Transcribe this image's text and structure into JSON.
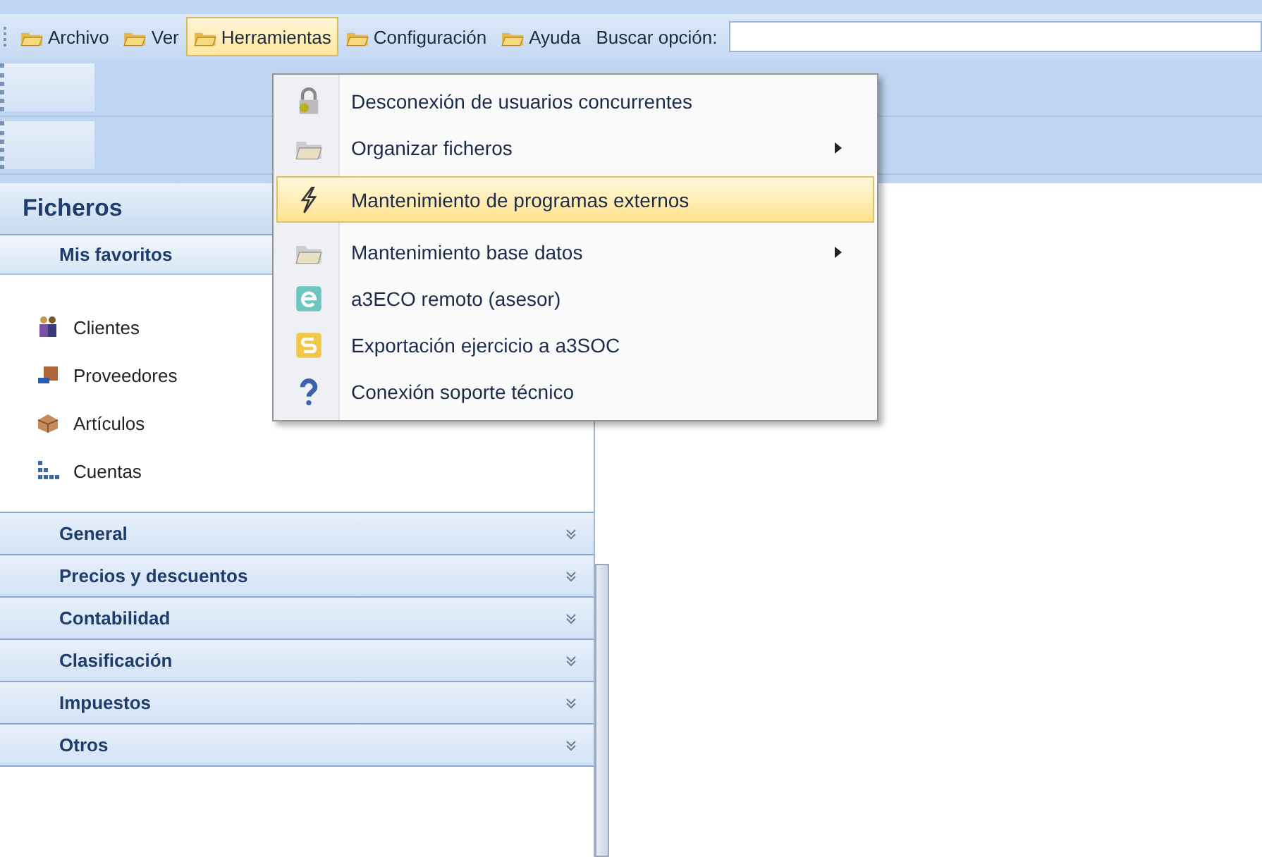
{
  "menubar": {
    "items": [
      {
        "label": "Archivo",
        "selected": false
      },
      {
        "label": "Ver",
        "selected": false
      },
      {
        "label": "Herramientas",
        "selected": true
      },
      {
        "label": "Configuración",
        "selected": false
      },
      {
        "label": "Ayuda",
        "selected": false
      }
    ],
    "search": {
      "label": "Buscar opción:"
    }
  },
  "menu": {
    "items": [
      {
        "label": "Desconexión de usuarios concurrentes",
        "selected": false,
        "submenu": false
      },
      {
        "label": "Organizar ficheros",
        "selected": false,
        "submenu": true
      },
      {
        "label": "Mantenimiento de programas externos",
        "selected": true,
        "submenu": false
      },
      {
        "label": "Mantenimiento base datos",
        "selected": false,
        "submenu": true
      },
      {
        "label": "a3ECO remoto (asesor)",
        "selected": false,
        "submenu": false
      },
      {
        "label": "Exportación ejercicio a a3SOC",
        "selected": false,
        "submenu": false
      },
      {
        "label": "Conexión soporte técnico",
        "selected": false,
        "submenu": false
      }
    ]
  },
  "sidebar": {
    "title": "Ficheros",
    "favorites": {
      "title": "Mis favoritos",
      "items": [
        {
          "label": "Clientes"
        },
        {
          "label": "Proveedores"
        },
        {
          "label": "Artículos"
        },
        {
          "label": "Cuentas"
        }
      ]
    },
    "groups": [
      {
        "label": "General",
        "expanded": false
      },
      {
        "label": "Precios y descuentos",
        "expanded": false
      },
      {
        "label": "Contabilidad",
        "expanded": false
      },
      {
        "label": "Clasificación",
        "expanded": false
      },
      {
        "label": "Impuestos",
        "expanded": false
      },
      {
        "label": "Otros",
        "expanded": false
      }
    ]
  }
}
